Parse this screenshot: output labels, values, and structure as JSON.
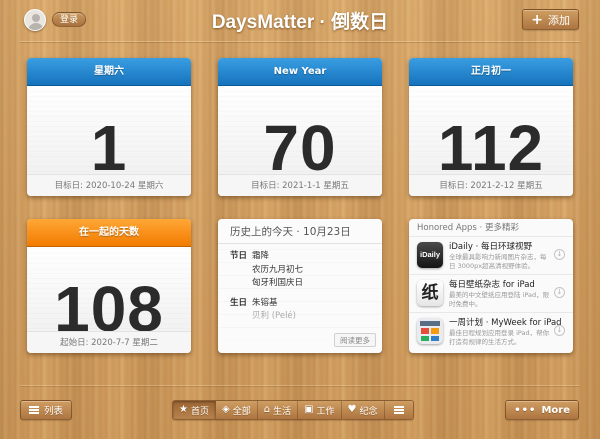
{
  "header": {
    "login": "登录",
    "title": "DaysMatter · 倒数日",
    "add": "添加"
  },
  "cards": [
    {
      "head": "星期六",
      "number": "1",
      "foot": "目标日: 2020-10-24 星期六",
      "color": "#1e86d4"
    },
    {
      "head": "New Year",
      "number": "70",
      "foot": "目标日: 2021-1-1 星期五",
      "color": "#1e86d4"
    },
    {
      "head": "正月初一",
      "number": "112",
      "foot": "目标日: 2021-2-12 星期五",
      "color": "#1e86d4"
    },
    {
      "head": "在一起的天数",
      "number": "108",
      "foot": "起始日: 2020-7-7 星期二",
      "color": "#f58a0a"
    }
  ],
  "history": {
    "title": "历史上的今天 · 10月23日",
    "rows": [
      {
        "k": "节日",
        "v": "霜降"
      },
      {
        "k": "",
        "v": "农历九月初七"
      },
      {
        "k": "",
        "v": "匈牙利国庆日"
      },
      {
        "k": "生日",
        "v": "朱镕基"
      },
      {
        "k": "",
        "v": "贝利 (Pelé)"
      }
    ],
    "more": "阅读更多"
  },
  "apps": {
    "title": "Honored Apps · 更多精彩",
    "items": [
      {
        "name": "iDaily · 每日环球视野",
        "desc": "全球最具影响力新闻图片杂志，每日 3000px超高清视野体验。",
        "icon": "iDaily"
      },
      {
        "name": "每日壁纸杂志 for iPad",
        "desc": "最美的中文壁纸应用登陆 iPad，限时免费中。",
        "icon": "纸"
      },
      {
        "name": "一周计划 · MyWeek for iPad",
        "desc": "最佳日程规划应用登录 iPad，帮你打造有规律的生活方式。",
        "icon": ""
      }
    ]
  },
  "footer": {
    "list": "列表",
    "tabs": [
      {
        "icon": "★",
        "label": "首页"
      },
      {
        "icon": "◈",
        "label": "全部"
      },
      {
        "icon": "⌂",
        "label": "生活"
      },
      {
        "icon": "▣",
        "label": "工作"
      },
      {
        "icon": "♥",
        "label": "纪念"
      }
    ],
    "more": "More"
  }
}
